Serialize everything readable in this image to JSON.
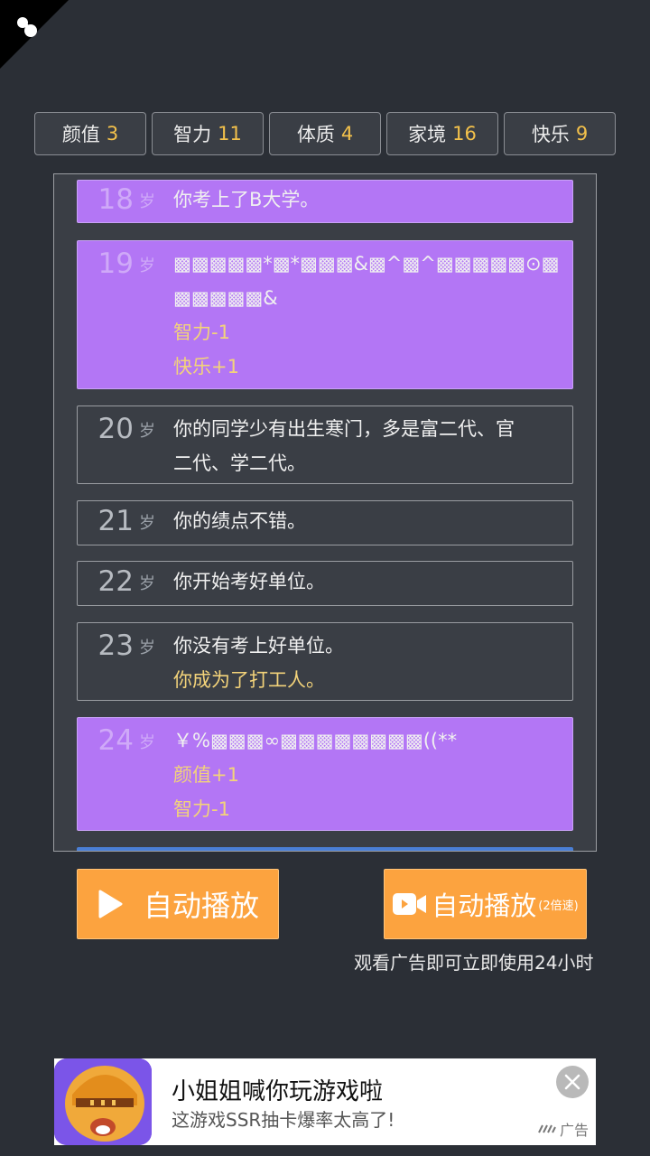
{
  "stats": [
    {
      "label": "颜值",
      "value": "3"
    },
    {
      "label": "智力",
      "value": "11"
    },
    {
      "label": "体质",
      "value": "4"
    },
    {
      "label": "家境",
      "value": "16"
    },
    {
      "label": "快乐",
      "value": "9"
    }
  ],
  "unit": "岁",
  "entries": [
    {
      "age": "18",
      "lines": [
        "你考上了B大学。"
      ]
    },
    {
      "age": "19",
      "lines": [
        "▩▩▩▩▩*▩*▩▩▩&▩^▩^▩▩▩▩▩⊙▩",
        "▩▩▩▩▩&"
      ],
      "effects": [
        "智力-1",
        "快乐+1"
      ]
    },
    {
      "age": "20",
      "lines": [
        "你的同学少有出生寒门，多是富二代、官",
        "二代、学二代。"
      ]
    },
    {
      "age": "21",
      "lines": [
        "你的绩点不错。"
      ]
    },
    {
      "age": "22",
      "lines": [
        "你开始考好单位。"
      ]
    },
    {
      "age": "23",
      "lines": [
        "你没有考上好单位。"
      ],
      "effects": [
        "你成为了打工人。"
      ]
    },
    {
      "age": "24",
      "lines": [
        "￥%▩▩▩∞▩▩▩▩▩▩▩▩((**"
      ],
      "effects": [
        "颜值+1",
        "智力-1"
      ]
    }
  ],
  "buttons": {
    "autoplay": "自动播放",
    "autoplay_fast": "自动播放",
    "autoplay_fast_sub": "(2倍速)"
  },
  "note": "观看广告即可立即使用24小时",
  "ad": {
    "title": "小姐姐喊你玩游戏啦",
    "desc": "这游戏SSR抽卡爆率太高了!",
    "tag": "广告"
  }
}
